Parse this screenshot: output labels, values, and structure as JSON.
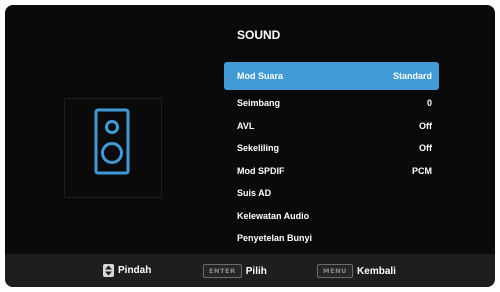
{
  "menu": {
    "title": "SOUND",
    "items": [
      {
        "label": "Mod Suara",
        "value": "Standard",
        "selected": true
      },
      {
        "label": "Seimbang",
        "value": "0"
      },
      {
        "label": "AVL",
        "value": "Off"
      },
      {
        "label": "Sekeliling",
        "value": "Off"
      },
      {
        "label": "Mod SPDIF",
        "value": "PCM"
      },
      {
        "label": "Suis AD",
        "value": ""
      },
      {
        "label": "Kelewatan Audio",
        "value": ""
      },
      {
        "label": "Penyetelan Bunyi",
        "value": ""
      }
    ]
  },
  "preview": {
    "icon": "speaker-icon",
    "color": "#3f9ad6"
  },
  "footer": {
    "move_label": "Pindah",
    "enter_key": "ENTER",
    "select_label": "Pilih",
    "menu_key": "MENU",
    "back_label": "Kembali"
  },
  "colors": {
    "accent": "#3f9ad6",
    "background": "#0a0a0a",
    "footer": "#1e1e1e"
  }
}
